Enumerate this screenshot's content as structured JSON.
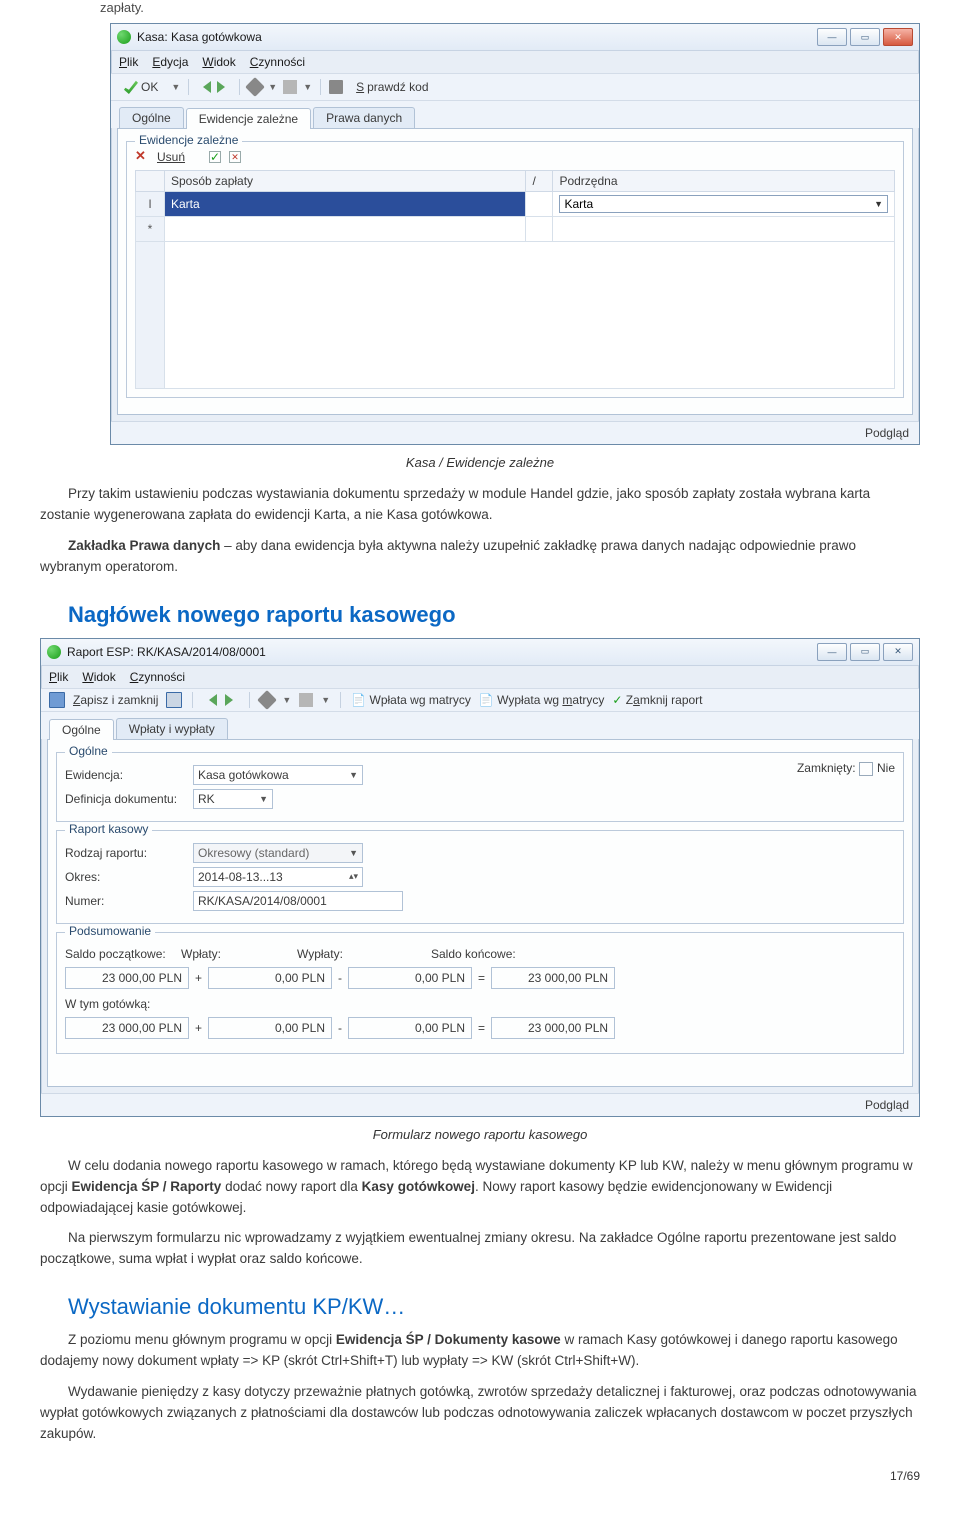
{
  "pageTop": "zapłaty.",
  "win1": {
    "title": "Kasa: Kasa gotówkowa",
    "menu": [
      "Plik",
      "Edycja",
      "Widok",
      "Czynności"
    ],
    "tb": {
      "ok": "OK",
      "sprawdz": "Sprawdź kod"
    },
    "tabs": [
      "Ogólne",
      "Ewidencje zależne",
      "Prawa danych"
    ],
    "activeTab": 1,
    "group": "Ewidencje zależne",
    "usun": "Usuń",
    "cols": [
      "Sposób zapłaty",
      "/",
      "Podrzędna"
    ],
    "cell_a": "Karta",
    "cell_b": "Karta",
    "status": "Podgląd"
  },
  "caption1": "Kasa / Ewidencje zależne",
  "para1": {
    "a": "Przy takim ustawieniu podczas wystawiania dokumentu sprzedaży w module Handel gdzie, jako sposób zapłaty została wybrana karta zostanie wygenerowana zapłata do ewidencji Karta, a nie Kasa gotówkowa.",
    "b_bold": "Zakładka Prawa danych",
    "b_rest": " – aby dana ewidencja była aktywna należy uzupełnić zakładkę prawa danych nadając odpowiednie prawo wybranym operatorom."
  },
  "h1": "Nagłówek nowego raportu kasowego",
  "win2": {
    "title": "Raport ESP: RK/KASA/2014/08/0001",
    "menu": [
      "Plik",
      "Widok",
      "Czynności"
    ],
    "tb": {
      "zapisz": "Zapisz i zamknij",
      "wplata": "Wpłata wg matrycy",
      "wyplata": "Wypłata wg matrycy",
      "zamknij": "Zamknij raport"
    },
    "tabs": [
      "Ogólne",
      "Wpłaty i wypłaty"
    ],
    "group1": "Ogólne",
    "zamkniety": {
      "label": "Zamknięty:",
      "val": "Nie"
    },
    "ewidencja": {
      "label": "Ewidencja:",
      "val": "Kasa gotówkowa"
    },
    "def": {
      "label": "Definicja dokumentu:",
      "val": "RK"
    },
    "group2": "Raport kasowy",
    "rodzaj": {
      "label": "Rodzaj raportu:",
      "val": "Okresowy (standard)"
    },
    "okres": {
      "label": "Okres:",
      "val": "2014-08-13...13"
    },
    "numer": {
      "label": "Numer:",
      "val": "RK/KASA/2014/08/0001"
    },
    "group3": "Podsumowanie",
    "labels": {
      "poczatkowe": "Saldo początkowe:",
      "wplaty": "Wpłaty:",
      "wyplaty": "Wypłaty:",
      "koncowe": "Saldo końcowe:",
      "gotowka": "W tym gotówką:"
    },
    "v": {
      "a": "23 000,00 PLN",
      "b": "0,00 PLN",
      "c": "0,00 PLN",
      "d": "23 000,00 PLN",
      "e": "23 000,00 PLN",
      "f": "0,00 PLN",
      "g": "0,00 PLN",
      "h": "23 000,00 PLN"
    },
    "status": "Podgląd"
  },
  "caption2": "Formularz nowego raportu kasowego",
  "para2": {
    "a1": "W celu dodania nowego raportu kasowego w ramach, którego będą wystawiane dokumenty KP lub KW, należy w menu głównym programu w opcji ",
    "a2_bold": "Ewidencja ŚP / Raporty",
    "a3": " dodać nowy raport dla ",
    "a4_bold": "Kasy gotówkowej",
    "a5": ". Nowy raport kasowy będzie ewidencjonowany w Ewidencji odpowiadającej kasie gotówkowej.",
    "b": "Na pierwszym formularzu nic wprowadzamy z wyjątkiem ewentualnej zmiany okresu. Na zakładce Ogólne raportu prezentowane jest saldo początkowe, suma wpłat i wypłat oraz saldo końcowe."
  },
  "h2": "Wystawianie dokumentu KP/KW…",
  "para3": {
    "a1": "Z poziomu menu głównym programu w opcji ",
    "a2_bold": "Ewidencja ŚP / Dokumenty kasowe",
    "a3": " w ramach Kasy gotówkowej i danego raportu kasowego dodajemy nowy dokument wpłaty => KP (skrót Ctrl+Shift+T) lub wypłaty => KW (skrót Ctrl+Shift+W).",
    "b": "Wydawanie pieniędzy z kasy dotyczy przeważnie płatnych gotówką, zwrotów sprzedaży detalicznej i fakturowej, oraz podczas odnotowywania wypłat gotówkowych związanych z płatnościami dla dostawców lub podczas odnotowywania zaliczek wpłacanych dostawcom w poczet przyszłych zakupów."
  },
  "pagenum": "17/69"
}
